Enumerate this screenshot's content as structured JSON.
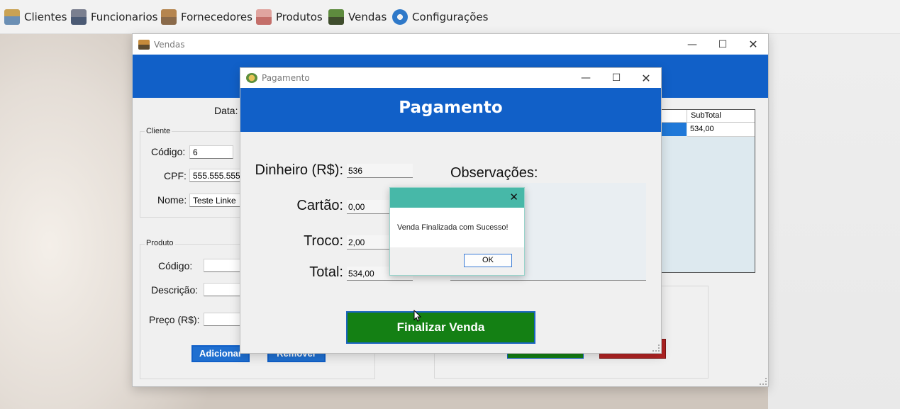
{
  "menu": {
    "items": [
      {
        "label": "Clientes",
        "icon": "clients-icon"
      },
      {
        "label": "Funcionarios",
        "icon": "employees-icon"
      },
      {
        "label": "Fornecedores",
        "icon": "suppliers-icon"
      },
      {
        "label": "Produtos",
        "icon": "products-icon"
      },
      {
        "label": "Vendas",
        "icon": "sales-icon"
      },
      {
        "label": "Configurações",
        "icon": "settings-gear-icon"
      }
    ]
  },
  "vendas_window": {
    "title": "Vendas",
    "data_label": "Data:",
    "cliente": {
      "group_title": "Cliente",
      "codigo_label": "Código:",
      "codigo_value": "6",
      "cpf_label": "CPF:",
      "cpf_value": "555.555.555-",
      "nome_label": "Nome:",
      "nome_value": "Teste Linke"
    },
    "produto": {
      "group_title": "Produto",
      "codigo_label": "Código:",
      "descricao_label": "Descrição:",
      "preco_label": "Preço (R$):",
      "codigo_value": "",
      "descricao_value": "",
      "preco_value": ""
    },
    "adicionar_label": "Adicionar",
    "remover_label": "Remover",
    "grid": {
      "column_subtotal": "SubTotal",
      "row_subtotal": "534,00"
    }
  },
  "pagamento_window": {
    "title": "Pagamento",
    "header": "Pagamento",
    "dinheiro_label": "Dinheiro (R$):",
    "dinheiro_value": "536",
    "cartao_label": "Cartão:",
    "cartao_value": "0,00",
    "troco_label": "Troco:",
    "troco_value": "2,00",
    "total_label": "Total:",
    "total_value": "534,00",
    "observacoes_label": "Observações:",
    "finalizar_label": "Finalizar Venda"
  },
  "message_box": {
    "text": "Venda Finalizada com Sucesso!",
    "ok_label": "OK"
  },
  "colors": {
    "header_blue": "#1160c8",
    "finalizar_green": "#148014",
    "msgbox_teal": "#47b8a8"
  }
}
